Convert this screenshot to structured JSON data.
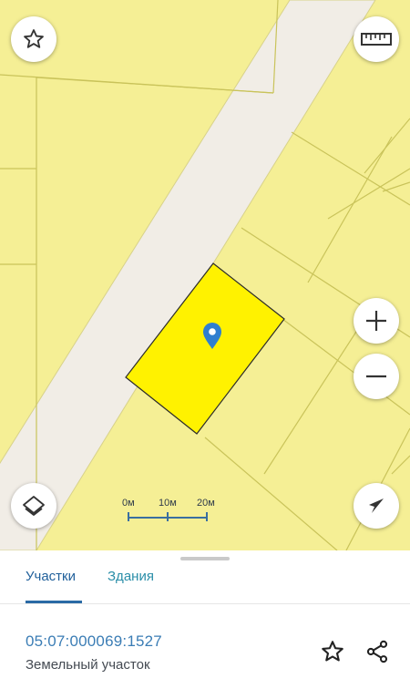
{
  "map": {
    "icons": {
      "favorite": "star-outline-icon",
      "ruler": "ruler-icon",
      "zoom_in": "plus-icon",
      "zoom_out": "minus-icon",
      "layers": "layers-icon",
      "locate": "navigation-arrow-icon",
      "marker": "map-pin-icon"
    },
    "colors": {
      "parcel_fill": "#f5ef95",
      "parcel_border": "#c9c35a",
      "road": "#f1ede6",
      "selected_parcel": "#fff300",
      "selected_border": "#222222",
      "marker": "#2f7fcf"
    },
    "scale": {
      "labels": [
        "0м",
        "10м",
        "20м"
      ]
    }
  },
  "sheet": {
    "tabs": [
      {
        "label": "Участки",
        "active": true
      },
      {
        "label": "Здания",
        "active": false
      }
    ],
    "object": {
      "cadastral_number": "05:07:000069:1527",
      "type": "Земельный участок"
    },
    "icons": {
      "favorite": "star-outline-icon",
      "share": "share-icon"
    }
  }
}
